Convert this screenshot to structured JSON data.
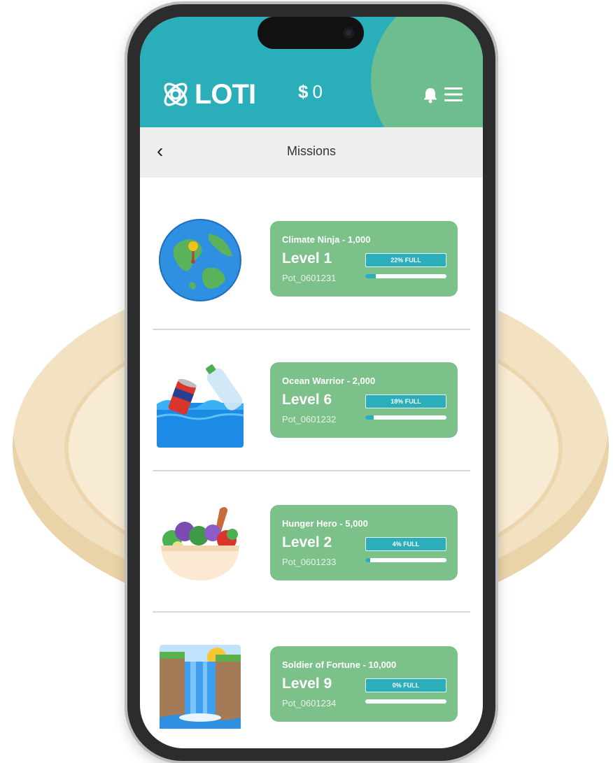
{
  "header": {
    "brand": "LOTI",
    "balance_currency": "$",
    "balance_value": "0"
  },
  "nav": {
    "back_label": "‹",
    "title": "Missions"
  },
  "missions": [
    {
      "title": "Climate Ninja - 1,000",
      "level": "Level 1",
      "pot": "Pot_0601231",
      "percent_label": "22% FULL",
      "fill": 0.13,
      "icon": "globe-icon"
    },
    {
      "title": "Ocean Warrior - 2,000",
      "level": "Level 6",
      "pot": "Pot_0601232",
      "percent_label": "18% FULL",
      "fill": 0.1,
      "icon": "ocean-plastic-icon"
    },
    {
      "title": "Hunger Hero - 5,000",
      "level": "Level 2",
      "pot": "Pot_0601233",
      "percent_label": "4% FULL",
      "fill": 0.06,
      "icon": "salad-bowl-icon"
    },
    {
      "title": "Soldier of Fortune - 10,000",
      "level": "Level 9",
      "pot": "Pot_0601234",
      "percent_label": "0% FULL",
      "fill": 0.0,
      "icon": "waterfall-icon"
    }
  ],
  "colors": {
    "teal": "#2aaeb9",
    "green": "#7cc08a",
    "coin": "#f3e2c2"
  }
}
